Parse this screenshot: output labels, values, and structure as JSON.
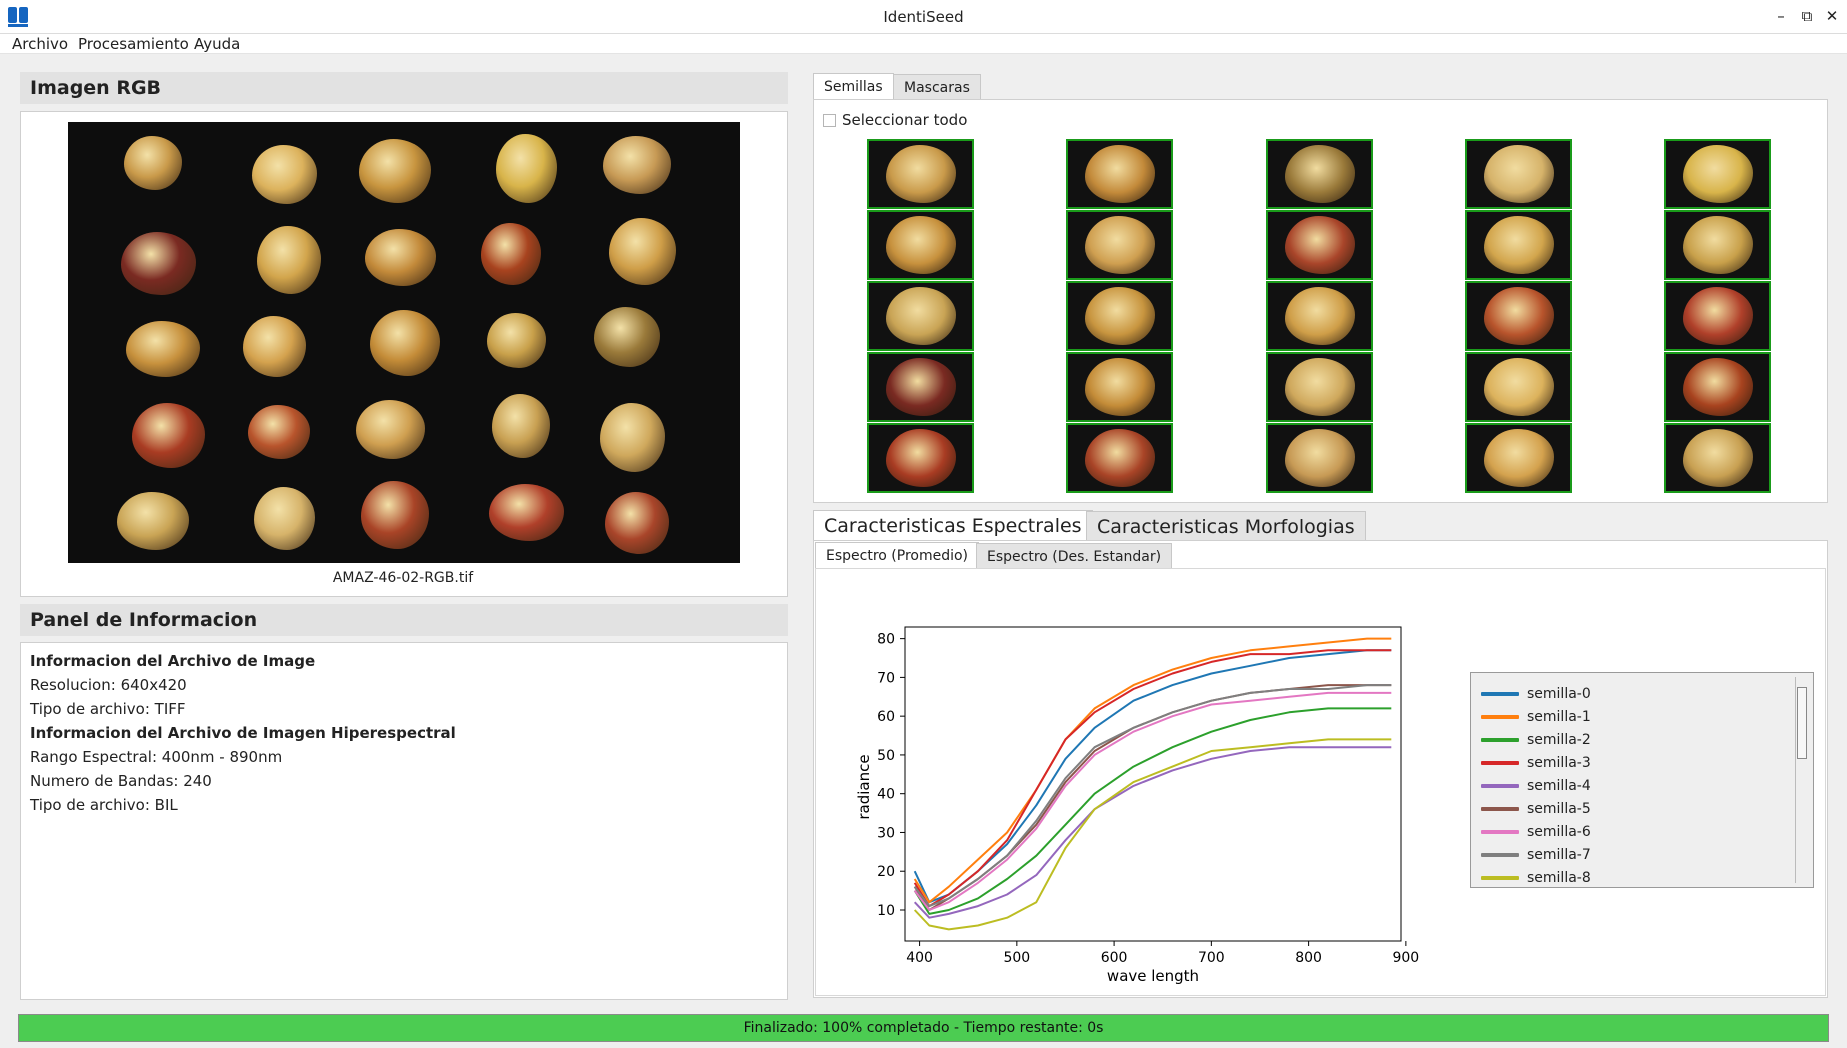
{
  "window": {
    "title": "IdentiSeed"
  },
  "window_controls": {
    "minimize": "–",
    "restore": "⧉",
    "close": "✕"
  },
  "menu": [
    "Archivo",
    "Procesamiento",
    "Ayuda"
  ],
  "rgb_panel": {
    "title": "Imagen RGB",
    "caption": "AMAZ-46-02-RGB.tif"
  },
  "info_panel": {
    "title": "Panel de Informacion",
    "lines": [
      {
        "text": "Informacion del Archivo de Image",
        "bold": true
      },
      {
        "text": "Resolucion: 640x420",
        "bold": false
      },
      {
        "text": "Tipo de archivo: TIFF",
        "bold": false
      },
      {
        "text": "Informacion del Archivo de Imagen Hiperespectral",
        "bold": true
      },
      {
        "text": "Rango Espectral: 400nm - 890nm",
        "bold": false
      },
      {
        "text": "Numero de Bandas: 240",
        "bold": false
      },
      {
        "text": "Tipo de archivo: BIL",
        "bold": false
      }
    ]
  },
  "seed_tabs": [
    "Semillas",
    "Mascaras"
  ],
  "select_all_label": "Seleccionar todo",
  "feature_tabs": [
    "Caracteristicas Espectrales",
    "Caracteristicas Morfologias"
  ],
  "spectrum_tabs": [
    "Espectro (Promedio)",
    "Espectro (Des. Estandar)"
  ],
  "seed_colors": [
    "#c99a4a",
    "#dcb25c",
    "#c8953f",
    "#d8b44a",
    "#c79a55",
    "#7a2a22",
    "#d2a54c",
    "#c38a3a",
    "#a8431f",
    "#cf9e48",
    "#c7913d",
    "#d4a24e",
    "#c48c38",
    "#c8a04a",
    "#9a7a3a",
    "#a93c23",
    "#b8542c",
    "#cf9f50",
    "#c8a052",
    "#cfa85c",
    "#c9a455",
    "#d6b36a",
    "#a94427",
    "#b0402a",
    "#a9452a"
  ],
  "chart_data": {
    "type": "line",
    "xlabel": "wave length",
    "ylabel": "radiance",
    "xlim": [
      385,
      895
    ],
    "ylim": [
      2,
      83
    ],
    "xticks": [
      400,
      500,
      600,
      700,
      800,
      900
    ],
    "yticks": [
      10,
      20,
      30,
      40,
      50,
      60,
      70,
      80
    ],
    "x": [
      395,
      410,
      430,
      460,
      490,
      520,
      550,
      580,
      620,
      660,
      700,
      740,
      780,
      820,
      860,
      885
    ],
    "series": [
      {
        "name": "semilla-0",
        "color": "#1f77b4",
        "values": [
          20,
          12,
          14,
          20,
          27,
          37,
          49,
          57,
          64,
          68,
          71,
          73,
          75,
          76,
          77,
          77
        ]
      },
      {
        "name": "semilla-1",
        "color": "#ff7f0e",
        "values": [
          18,
          12,
          16,
          23,
          30,
          41,
          54,
          62,
          68,
          72,
          75,
          77,
          78,
          79,
          80,
          80
        ]
      },
      {
        "name": "semilla-2",
        "color": "#2ca02c",
        "values": [
          15,
          9,
          10,
          13,
          18,
          24,
          32,
          40,
          47,
          52,
          56,
          59,
          61,
          62,
          62,
          62
        ]
      },
      {
        "name": "semilla-3",
        "color": "#d62728",
        "values": [
          17,
          11,
          14,
          20,
          28,
          41,
          54,
          61,
          67,
          71,
          74,
          76,
          76,
          77,
          77,
          77
        ]
      },
      {
        "name": "semilla-4",
        "color": "#9467bd",
        "values": [
          12,
          8,
          9,
          11,
          14,
          19,
          28,
          36,
          42,
          46,
          49,
          51,
          52,
          52,
          52,
          52
        ]
      },
      {
        "name": "semilla-5",
        "color": "#8c564b",
        "values": [
          16,
          10,
          13,
          18,
          24,
          32,
          43,
          51,
          57,
          61,
          64,
          66,
          67,
          68,
          68,
          68
        ]
      },
      {
        "name": "semilla-6",
        "color": "#e377c2",
        "values": [
          15,
          10,
          12,
          17,
          23,
          31,
          42,
          50,
          56,
          60,
          63,
          64,
          65,
          66,
          66,
          66
        ]
      },
      {
        "name": "semilla-7",
        "color": "#7f7f7f",
        "values": [
          16,
          11,
          13,
          18,
          24,
          33,
          44,
          52,
          57,
          61,
          64,
          66,
          67,
          67,
          68,
          68
        ]
      },
      {
        "name": "semilla-8",
        "color": "#bcbd22",
        "values": [
          10,
          6,
          5,
          6,
          8,
          12,
          26,
          36,
          43,
          47,
          51,
          52,
          53,
          54,
          54,
          54
        ]
      }
    ]
  },
  "status": {
    "text": "Finalizado: 100% completado - Tiempo restante: 0s",
    "progress": 1.0
  }
}
